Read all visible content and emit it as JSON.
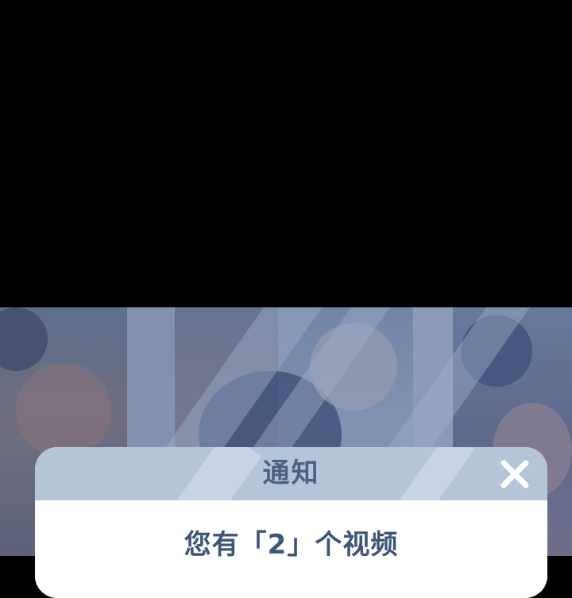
{
  "dialog": {
    "title": "通知",
    "message": "您有「2」个视频",
    "close_icon": "close-icon"
  },
  "colors": {
    "header_bg": "#afc0d6",
    "title_text": "#4a6184",
    "message_text": "#3f5578",
    "close_icon": "#ffffff"
  }
}
